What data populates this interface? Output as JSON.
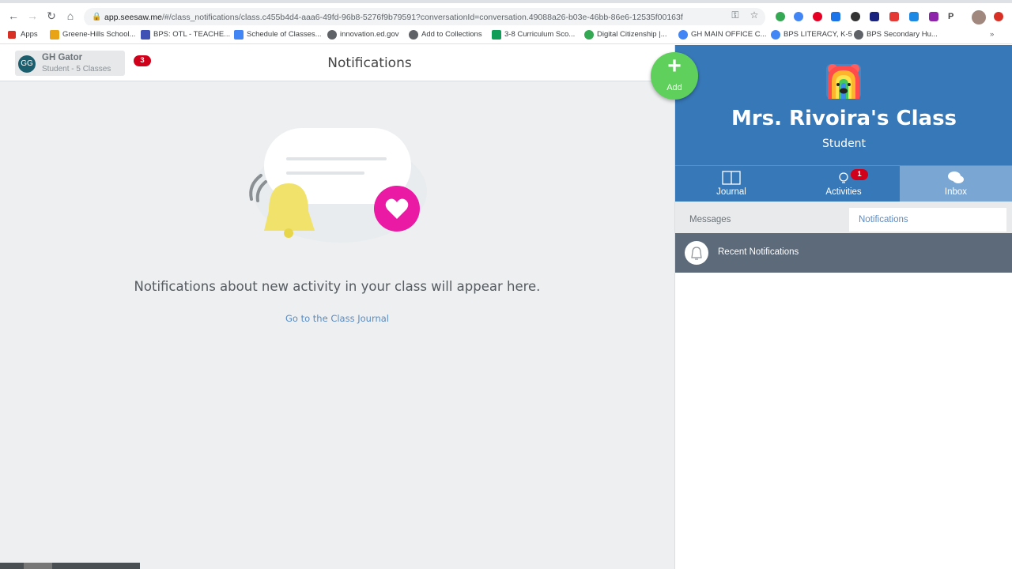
{
  "browser": {
    "url_host": "app.seesaw.me",
    "url_path": "/#/class_notifications/class.c455b4d4-aaa6-49fd-96b8-5276f9b79591?conversationId=conversation.49088a26-b03e-46bb-86e6-12535f00163f",
    "bookmarks": [
      {
        "label": "Apps",
        "icon": "apps-grid-icon",
        "color": "#d93025"
      },
      {
        "label": "Greene-Hills School...",
        "icon": "school-icon",
        "color": "#e8a317"
      },
      {
        "label": "BPS: OTL - TEACHE...",
        "icon": "calendar-icon",
        "color": "#3f51b5"
      },
      {
        "label": "Schedule of Classes...",
        "icon": "doc-icon",
        "color": "#4285f4"
      },
      {
        "label": "innovation.ed.gov",
        "icon": "globe-icon",
        "color": "#5f6368"
      },
      {
        "label": "Add to Collections",
        "icon": "globe-icon",
        "color": "#5f6368"
      },
      {
        "label": "3-8 Curriculum Sco...",
        "icon": "drive-icon",
        "color": "#0f9d58"
      },
      {
        "label": "Digital Citizenship |...",
        "icon": "check-icon",
        "color": "#34a853"
      },
      {
        "label": "GH MAIN OFFICE C...",
        "icon": "google-icon",
        "color": "#4285f4"
      },
      {
        "label": "BPS LITERACY, K-5",
        "icon": "google-icon",
        "color": "#4285f4"
      },
      {
        "label": "BPS Secondary Hu...",
        "icon": "globe-icon",
        "color": "#5f6368"
      }
    ]
  },
  "account": {
    "initials": "GG",
    "name": "GH Gator",
    "subtitle": "Student - 5 Classes",
    "badge": "3"
  },
  "page": {
    "title": "Notifications",
    "empty_message": "Notifications about new activity in your class will appear here.",
    "journal_link": "Go to the Class Journal"
  },
  "add_button": {
    "label": "Add"
  },
  "class_panel": {
    "class_name": "Mrs. Rivoira's Class",
    "role": "Student",
    "tabs": [
      {
        "label": "Journal",
        "icon": "journal-book-icon",
        "badge": ""
      },
      {
        "label": "Activities",
        "icon": "lightbulb-icon",
        "badge": "1"
      },
      {
        "label": "Inbox",
        "icon": "chat-bubbles-icon",
        "badge": ""
      }
    ],
    "subtabs": [
      {
        "label": "Messages"
      },
      {
        "label": "Notifications"
      }
    ],
    "recent_label": "Recent Notifications"
  },
  "colors": {
    "brand_blue": "#3778b8",
    "active_tab": "#7aa6d4",
    "add_green": "#5fd05b",
    "badge_red": "#d0021b",
    "recent_bar": "#5d6a7a"
  }
}
